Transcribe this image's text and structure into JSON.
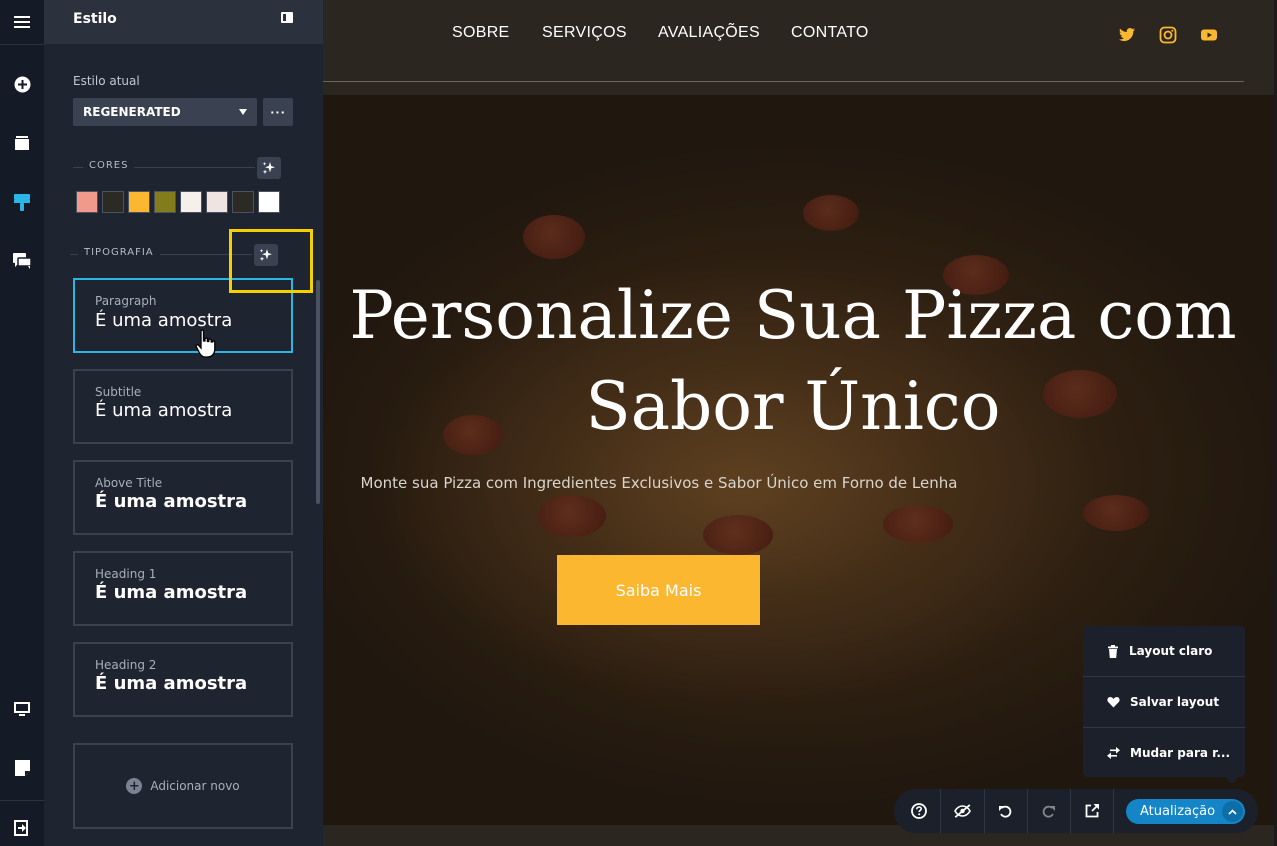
{
  "panel": {
    "title": "Estilo",
    "current_style_label": "Estilo atual",
    "current_style_value": "REGENERATED",
    "more_label": "···",
    "colors_label": "CORES",
    "typography_label": "TIPOGRAFIA",
    "swatches": [
      "#ef9a8a",
      "#2b2a25",
      "#fcb731",
      "#837c1a",
      "#f5f1ea",
      "#f0e4e2",
      "#2b2a25",
      "#ffffff"
    ],
    "typography": [
      {
        "name": "Paragraph",
        "sample": "É uma amostra",
        "selected": true
      },
      {
        "name": "Subtitle",
        "sample": "É uma amostra"
      },
      {
        "name": "Above Title",
        "sample": "É uma amostra"
      },
      {
        "name": "Heading 1",
        "sample": "É uma amostra"
      },
      {
        "name": "Heading 2",
        "sample": "É uma amostra"
      }
    ],
    "add_new": "Adicionar novo"
  },
  "site": {
    "nav": [
      "SOBRE",
      "SERVIÇOS",
      "AVALIAÇÕES",
      "CONTATO"
    ],
    "hero_title_line1": "Personalize Sua Pizza com",
    "hero_title_line2": "Sabor Único",
    "hero_subtitle": "Monte sua Pizza com Ingredientes Exclusivos e Sabor Único em Forno de Lenha",
    "cta": "Saiba Mais",
    "accent": "#fcb731"
  },
  "popup": {
    "items": [
      "Layout claro",
      "Salvar layout",
      "Mudar para r..."
    ]
  },
  "toolbar": {
    "update": "Atualização"
  }
}
